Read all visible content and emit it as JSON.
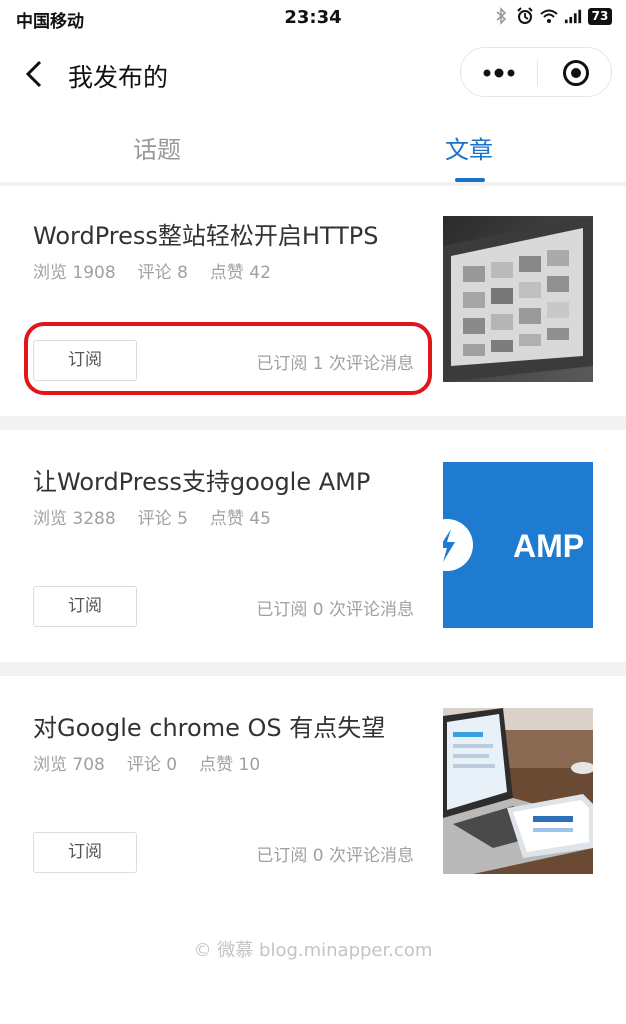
{
  "status_bar": {
    "carrier": "中国移动",
    "time": "23:34",
    "battery": "73"
  },
  "nav": {
    "title": "我发布的"
  },
  "tabs": [
    {
      "label": "话题",
      "active": false
    },
    {
      "label": "文章",
      "active": true
    }
  ],
  "articles": [
    {
      "title": "WordPress整站轻松开启HTTPS",
      "views": "浏览 1908",
      "comments": "评论 8",
      "likes": "点赞 42",
      "subscribe_label": "订阅",
      "subscription_info": "已订阅 1 次评论消息"
    },
    {
      "title": "让WordPress支持google AMP",
      "views": "浏览 3288",
      "comments": "评论 5",
      "likes": "点赞 45",
      "subscribe_label": "订阅",
      "subscription_info": "已订阅 0 次评论消息",
      "thumb_text": "AMP"
    },
    {
      "title": "对Google chrome OS 有点失望",
      "views": "浏览 708",
      "comments": "评论 0",
      "likes": "点赞 10",
      "subscribe_label": "订阅",
      "subscription_info": "已订阅 0 次评论消息"
    }
  ],
  "footer": "© 微慕 blog.minapper.com",
  "colors": {
    "accent": "#1a73c8",
    "highlight": "#e0161a",
    "amp_blue": "#1f7bcf"
  }
}
